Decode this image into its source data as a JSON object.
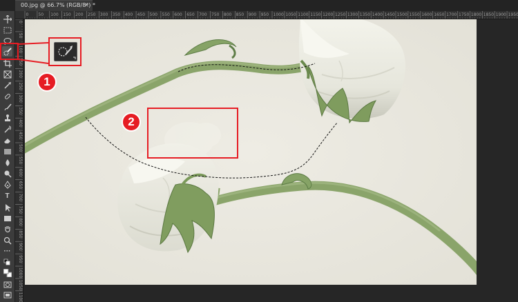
{
  "document_tab": {
    "title": "00.jpg @ 66.7% (RGB/8*) *",
    "close_label": "×"
  },
  "ruler_top_labels": [
    "0",
    "50",
    "100",
    "150",
    "200",
    "250",
    "300",
    "350",
    "400",
    "450",
    "500",
    "550",
    "600",
    "650",
    "700",
    "750",
    "800",
    "850",
    "900",
    "950",
    "1000",
    "1050",
    "1100",
    "1150",
    "1200",
    "1250",
    "1300",
    "1350",
    "1400",
    "1450",
    "1500",
    "1550",
    "1600",
    "1650",
    "1700",
    "1750",
    "1800",
    "1850",
    "1900",
    "1950"
  ],
  "ruler_left_labels": [
    "0",
    "50",
    "100",
    "150",
    "200",
    "250",
    "300",
    "350",
    "400",
    "450",
    "500",
    "550",
    "600",
    "650",
    "700",
    "750",
    "800",
    "850",
    "900",
    "950",
    "1000",
    "1050",
    "1100"
  ],
  "toolbar": {
    "tools": [
      {
        "icon": "move-icon"
      },
      {
        "icon": "marquee-icon"
      },
      {
        "icon": "lasso-icon"
      },
      {
        "icon": "quick-selection-icon",
        "active": true
      },
      {
        "icon": "crop-icon"
      },
      {
        "icon": "frame-icon"
      },
      {
        "icon": "eyedropper-icon"
      },
      {
        "icon": "healing-brush-icon"
      },
      {
        "icon": "brush-icon"
      },
      {
        "icon": "clone-stamp-icon"
      },
      {
        "icon": "history-brush-icon"
      },
      {
        "icon": "eraser-icon"
      },
      {
        "icon": "gradient-icon"
      },
      {
        "icon": "blur-icon"
      },
      {
        "icon": "dodge-icon"
      },
      {
        "icon": "pen-icon"
      },
      {
        "icon": "type-icon",
        "glyph": "T"
      },
      {
        "icon": "path-selection-icon"
      },
      {
        "icon": "rectangle-icon"
      },
      {
        "icon": "hand-icon"
      },
      {
        "icon": "zoom-icon"
      },
      {
        "icon": "more-tools-icon",
        "glyph": "···"
      },
      {
        "icon": "default-colors-icon"
      },
      {
        "icon": "color-swatches-icon"
      },
      {
        "icon": "quick-mask-icon"
      },
      {
        "icon": "screen-mode-icon"
      }
    ]
  },
  "annotations": {
    "marker_1": "1",
    "marker_2": "2",
    "color": "#e61c23"
  },
  "colors": {
    "background": "#eae8df",
    "stem": "#8ea86d",
    "petal": "#efefe6"
  }
}
